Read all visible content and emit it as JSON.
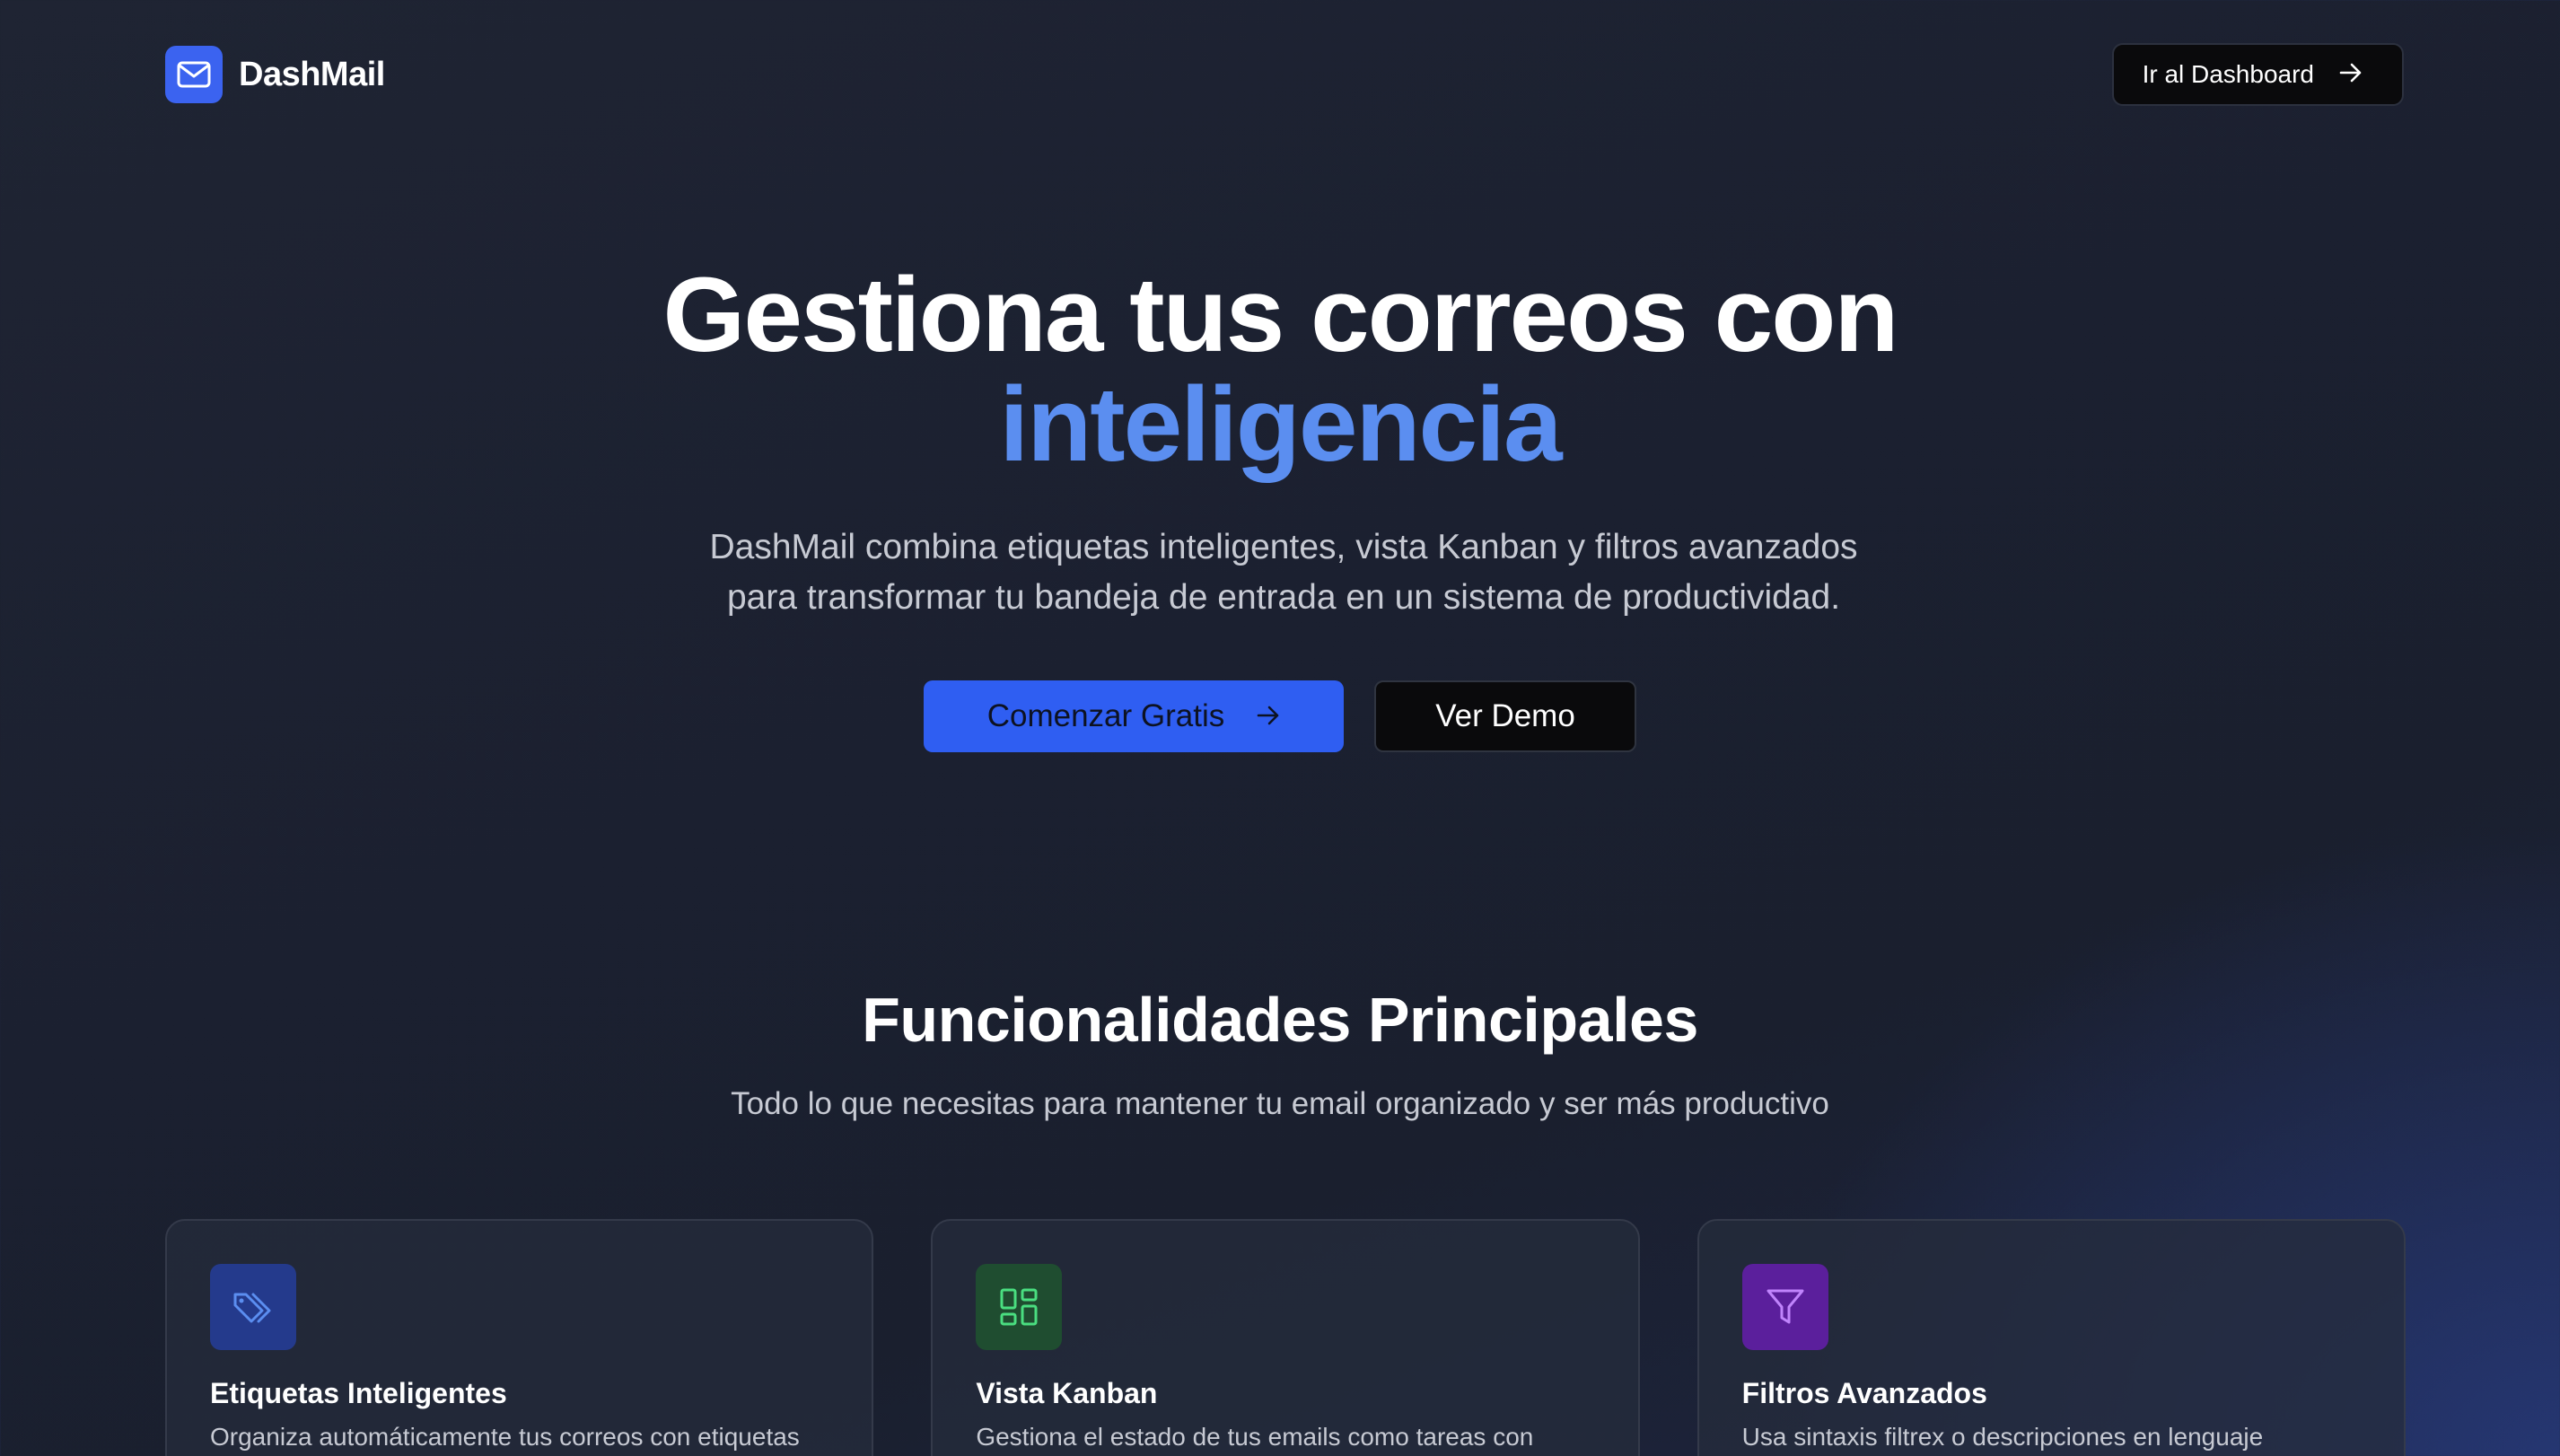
{
  "header": {
    "brand_name": "DashMail",
    "logo_icon": "mail-icon",
    "dashboard_button_label": "Ir al Dashboard",
    "dashboard_button_icon": "arrow-right-icon"
  },
  "hero": {
    "title_line1": "Gestiona tus correos con",
    "title_accent": "inteligencia",
    "subtitle_line1": "DashMail combina etiquetas inteligentes, vista Kanban y filtros avanzados",
    "subtitle_line2": "para transformar tu bandeja de entrada en un sistema de productividad.",
    "primary_cta_label": "Comenzar Gratis",
    "primary_cta_icon": "arrow-right-icon",
    "secondary_cta_label": "Ver Demo"
  },
  "features": {
    "title": "Funcionalidades Principales",
    "subtitle": "Todo lo que necesitas para mantener tu email organizado y ser más productivo",
    "cards": [
      {
        "icon": "tags-icon",
        "icon_bg": "#243a8c",
        "icon_color": "#5b8ef0",
        "title": "Etiquetas Inteligentes",
        "description": "Organiza automáticamente tus correos con etiquetas"
      },
      {
        "icon": "kanban-board-icon",
        "icon_bg": "#1f4d30",
        "icon_color": "#4ade80",
        "title": "Vista Kanban",
        "description": "Gestiona el estado de tus emails como tareas con"
      },
      {
        "icon": "filter-icon",
        "icon_bg": "#5b1f9c",
        "icon_color": "#c084fc",
        "title": "Filtros Avanzados",
        "description": "Usa sintaxis filtrex o descripciones en lenguaje"
      }
    ]
  },
  "colors": {
    "accent": "#3b63f0",
    "accent_text": "#5b8ef0",
    "background": "#1c2130"
  }
}
